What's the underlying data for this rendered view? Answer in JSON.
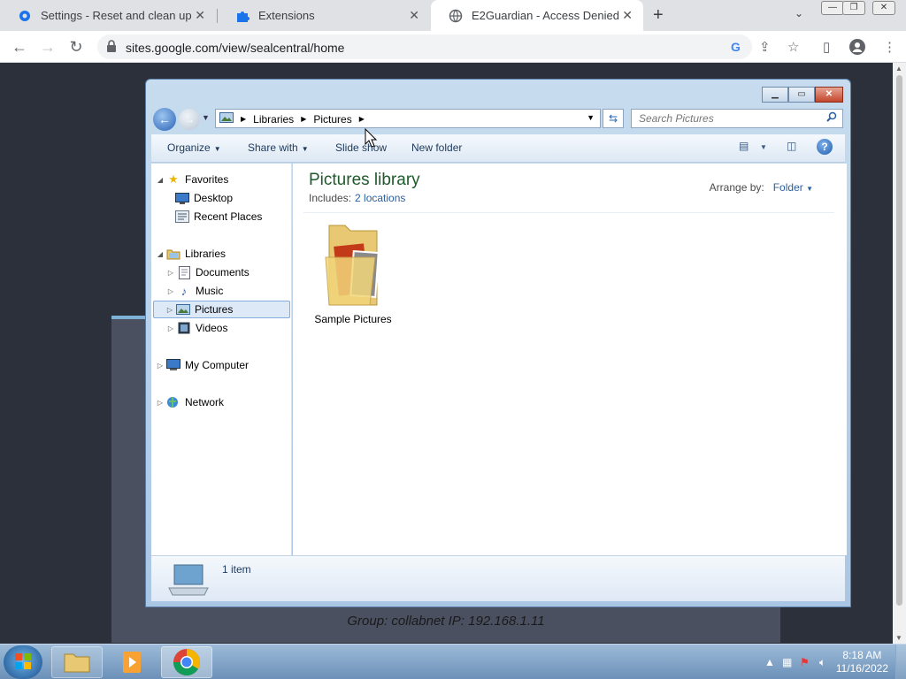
{
  "browser": {
    "tabs": [
      {
        "label": "Settings - Reset and clean up",
        "icon": "gear-icon"
      },
      {
        "label": "Extensions",
        "icon": "puzzle-icon"
      },
      {
        "label": "E2Guardian - Access Denied",
        "icon": "globe-icon"
      }
    ],
    "url": "sites.google.com/view/sealcentral/home"
  },
  "page": {
    "footer_text": "Group: collabnet    IP: 192.168.1.11"
  },
  "explorer": {
    "breadcrumbs": [
      "Libraries",
      "Pictures"
    ],
    "search_placeholder": "Search Pictures",
    "commands": [
      "Organize",
      "Share with",
      "Slide show",
      "New folder"
    ],
    "nav": {
      "favorites": {
        "label": "Favorites",
        "items": [
          "Desktop",
          "Recent Places"
        ]
      },
      "libraries": {
        "label": "Libraries",
        "items": [
          "Documents",
          "Music",
          "Pictures",
          "Videos"
        ]
      },
      "computer": "My Computer",
      "network": "Network"
    },
    "library_title": "Pictures library",
    "includes_label": "Includes:",
    "includes_link": "2 locations",
    "arrange_label": "Arrange by:",
    "arrange_value": "Folder",
    "items": [
      {
        "name": "Sample Pictures"
      }
    ],
    "status_count": "1 item"
  },
  "taskbar": {
    "time": "8:18 AM",
    "date": "11/16/2022"
  },
  "colors": {
    "library_title": "#1e5a2c",
    "link": "#2a5fa0",
    "selection": "#dde9f7"
  }
}
